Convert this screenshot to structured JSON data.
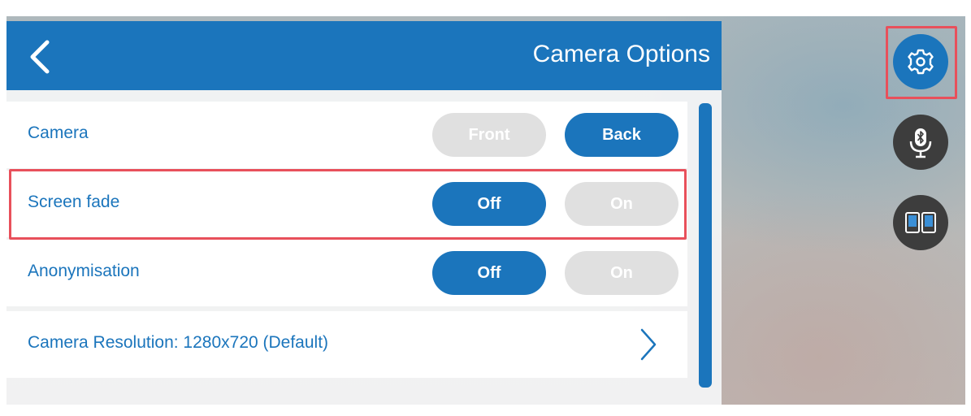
{
  "header": {
    "title": "Camera Options",
    "back_icon": "chevron-left-icon"
  },
  "rows": [
    {
      "label": "Camera",
      "left_option": "Front",
      "right_option": "Back",
      "selected": "Back"
    },
    {
      "label": "Screen fade",
      "left_option": "Off",
      "right_option": "On",
      "selected": "Off"
    },
    {
      "label": "Anonymisation",
      "left_option": "Off",
      "right_option": "On",
      "selected": "Off"
    },
    {
      "label": "Camera Resolution: 1280x720 (Default)",
      "icon": "chevron-right-icon"
    }
  ],
  "side_buttons": [
    {
      "icon": "gear-icon",
      "active": true
    },
    {
      "icon": "bluetooth-microphone-icon",
      "active": false
    },
    {
      "icon": "split-screen-icon",
      "active": false
    }
  ],
  "colors": {
    "accent": "#1b75bc",
    "inactive": "#e0e0e0",
    "highlight": "#e8505b",
    "dark_button": "#3d3d3d"
  }
}
